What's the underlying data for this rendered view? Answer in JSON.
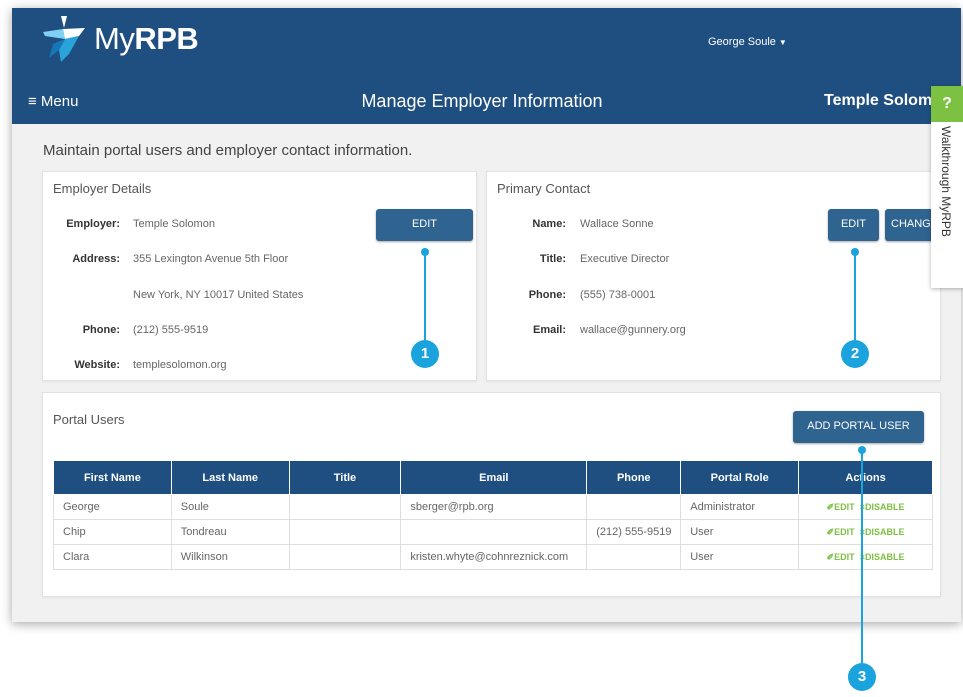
{
  "header": {
    "logo_prefix": "My",
    "logo_brand": "RPB",
    "user_name": "George Soule",
    "menu_label": "≡ Menu",
    "page_title": "Manage Employer Information",
    "org_name": "Temple Solomon"
  },
  "intro_text": "Maintain portal users and employer contact information.",
  "employer_details": {
    "title": "Employer Details",
    "edit_label": "EDIT",
    "employer_label": "Employer:",
    "employer_value": "Temple Solomon",
    "address_label": "Address:",
    "address_line1": "355 Lexington Avenue 5th Floor",
    "address_line2": "New York, NY 10017 United States",
    "phone_label": "Phone:",
    "phone_value": "(212) 555-9519",
    "website_label": "Website:",
    "website_value": "templesolomon.org"
  },
  "primary_contact": {
    "title": "Primary Contact",
    "edit_label": "EDIT",
    "change_label": "CHANG",
    "name_label": "Name:",
    "name_value": "Wallace Sonne",
    "title_label": "Title:",
    "title_value": "Executive Director",
    "phone_label": "Phone:",
    "phone_value": "(555) 738-0001",
    "email_label": "Email:",
    "email_value": "wallace@gunnery.org"
  },
  "portal_users": {
    "title": "Portal Users",
    "add_label": "ADD PORTAL USER",
    "columns": [
      "First Name",
      "Last Name",
      "Title",
      "Email",
      "Phone",
      "Portal Role",
      "Actions"
    ],
    "edit_action": "✐EDIT",
    "disable_action": "×DISABLE",
    "rows": [
      {
        "first": "George",
        "last": "Soule",
        "title": "",
        "email": "sberger@rpb.org",
        "phone": "",
        "role": "Administrator"
      },
      {
        "first": "Chip",
        "last": "Tondreau",
        "title": "",
        "email": "",
        "phone": "(212) 555-9519",
        "role": "User"
      },
      {
        "first": "Clara",
        "last": "Wilkinson",
        "title": "",
        "email": "kristen.whyte@cohnreznick.com",
        "phone": "",
        "role": "User"
      }
    ]
  },
  "help_tab": {
    "icon": "?",
    "label": "Walkthrough MyRPB"
  },
  "callouts": [
    "1",
    "2",
    "3"
  ],
  "colors": {
    "header": "#1e4f80",
    "button": "#2f6390",
    "accent_green": "#7dc142",
    "callout_blue": "#1aa3dc"
  }
}
